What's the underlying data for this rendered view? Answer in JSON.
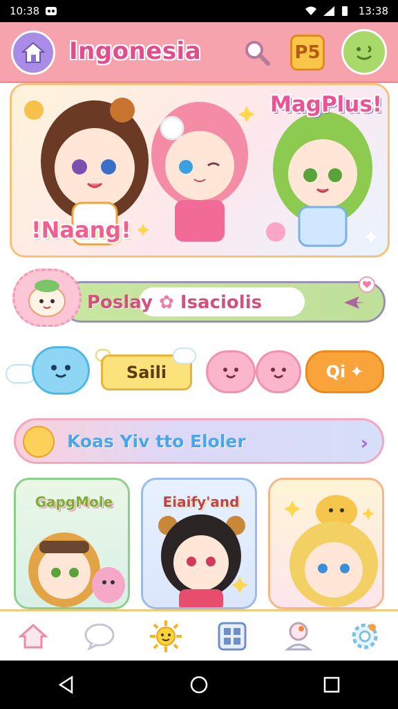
{
  "status_bar": {
    "time_left": "10:38",
    "time_right": "13:38",
    "icons": [
      "notification-icon",
      "wifi-icon",
      "signal-icon",
      "battery-icon"
    ]
  },
  "header": {
    "title": "Ingonesia",
    "icons": [
      "home-icon",
      "search-icon",
      "ps-badge-icon",
      "smiley-icon"
    ],
    "badge_label": "P5"
  },
  "hero": {
    "tag_left": "!Naang!",
    "tag_right": "MagPlus!"
  },
  "pill_row": {
    "text": "Poslay",
    "text2": "Isaciolis"
  },
  "actions": {
    "sali_label": "Saili",
    "qi_label": "Qi"
  },
  "banner": {
    "text": "Koas Yiv tto Eloler"
  },
  "cards": [
    {
      "title": "GapgMole"
    },
    {
      "title": "Eiaify'and"
    },
    {
      "title": ""
    }
  ],
  "bottom_nav": {
    "items": [
      "home-icon",
      "chat-icon",
      "sun-icon",
      "grid-icon",
      "profile-icon",
      "gear-icon"
    ]
  },
  "colors": {
    "header_bg": "#f7a3ae",
    "title_pink": "#e04e8c",
    "accent_orange": "#f9a43a",
    "banner_blue_text": "#4aa6e8"
  }
}
